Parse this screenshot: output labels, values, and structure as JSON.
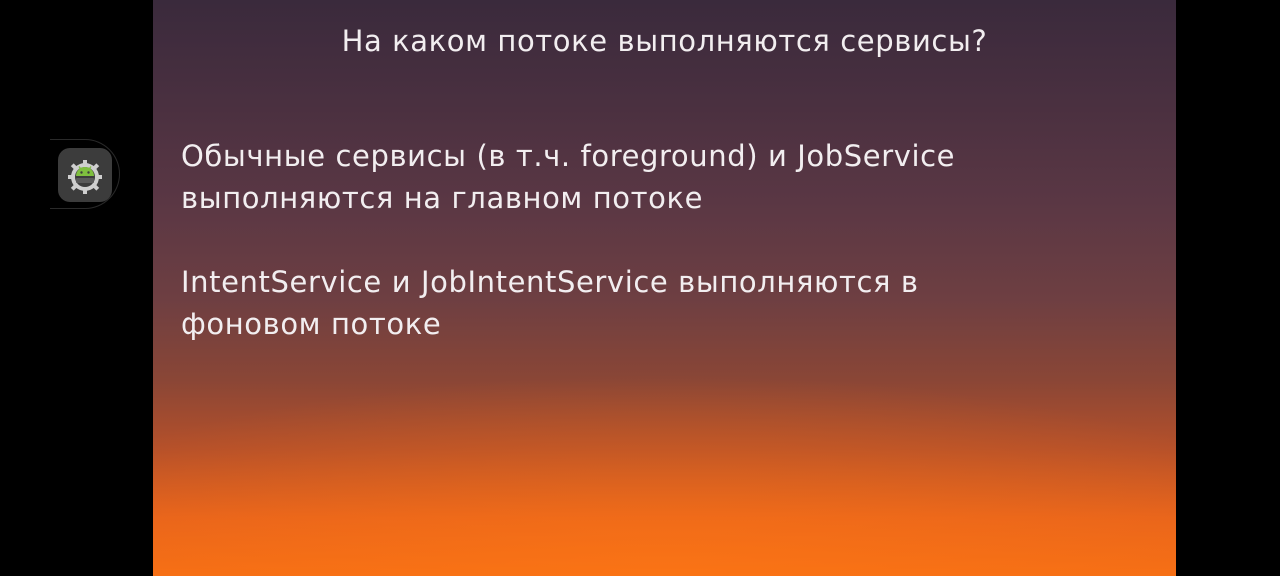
{
  "slide": {
    "title": "На каком потоке выполняются сервисы?",
    "bullets": [
      {
        "lines": [
          "Обычные сервисы (в т.ч. foreground) и JobService",
          "выполняются на главном потоке"
        ]
      },
      {
        "lines": [
          "IntentService и JobIntentService выполняются в",
          "фоновом потоке"
        ]
      }
    ]
  },
  "floating_button": {
    "icon": "android-gear-icon"
  },
  "colors": {
    "text": "#f2eef0",
    "gradient_top": "#3a2a3c",
    "gradient_bottom": "#f56e15",
    "letterbox": "#000000"
  }
}
